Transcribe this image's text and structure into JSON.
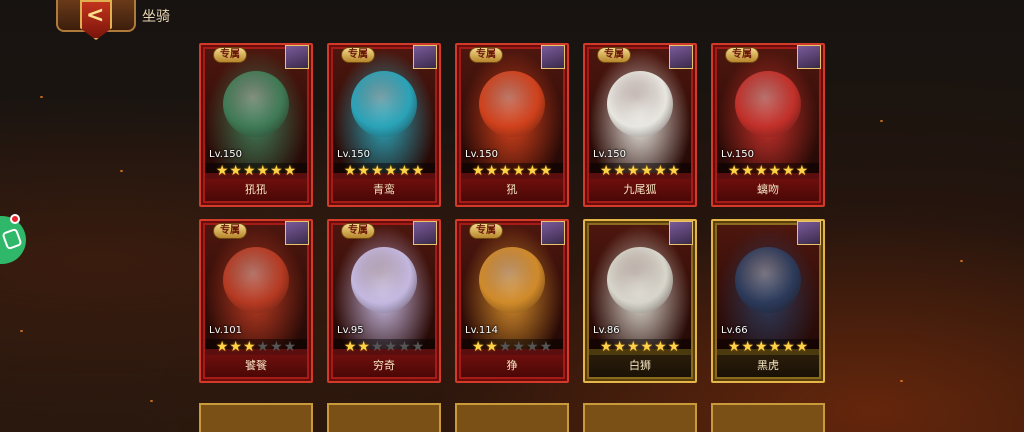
{
  "header": {
    "title": "坐骑",
    "back_icon": "back-arrow-icon"
  },
  "colors": {
    "red_frame": "#a51b18",
    "gold_frame": "#e4b64a",
    "star": "#ffd24a"
  },
  "mounts": [
    {
      "name": "犼犼",
      "level": "Lv.150",
      "stars": 6,
      "exclusive_label": "专属",
      "frame": "red",
      "art": "#3f7a55"
    },
    {
      "name": "青鸾",
      "level": "Lv.150",
      "stars": 6,
      "exclusive_label": "专属",
      "frame": "red",
      "art": "#2aa3b8"
    },
    {
      "name": "犼",
      "level": "Lv.150",
      "stars": 6,
      "exclusive_label": "专属",
      "frame": "red",
      "art": "#d0411c"
    },
    {
      "name": "九尾狐",
      "level": "Lv.150",
      "stars": 6,
      "exclusive_label": "专属",
      "frame": "red",
      "art": "#e8e6e0"
    },
    {
      "name": "螭吻",
      "level": "Lv.150",
      "stars": 6,
      "exclusive_label": "专属",
      "frame": "red",
      "art": "#c2302a"
    },
    {
      "name": "饕餮",
      "level": "Lv.101",
      "stars": 3,
      "exclusive_label": "专属",
      "frame": "red",
      "art": "#b63a22"
    },
    {
      "name": "穷奇",
      "level": "Lv.95",
      "stars": 2,
      "exclusive_label": "专属",
      "frame": "red",
      "art": "#c4b8e0"
    },
    {
      "name": "狰",
      "level": "Lv.114",
      "stars": 2,
      "exclusive_label": "专属",
      "frame": "red",
      "art": "#d08a2a"
    },
    {
      "name": "白狮",
      "level": "Lv.86",
      "stars": 6,
      "exclusive_label": "",
      "frame": "gold",
      "art": "#d8d6cc"
    },
    {
      "name": "黑虎",
      "level": "Lv.66",
      "stars": 6,
      "exclusive_label": "",
      "frame": "gold",
      "art": "#2c3a5a"
    }
  ]
}
